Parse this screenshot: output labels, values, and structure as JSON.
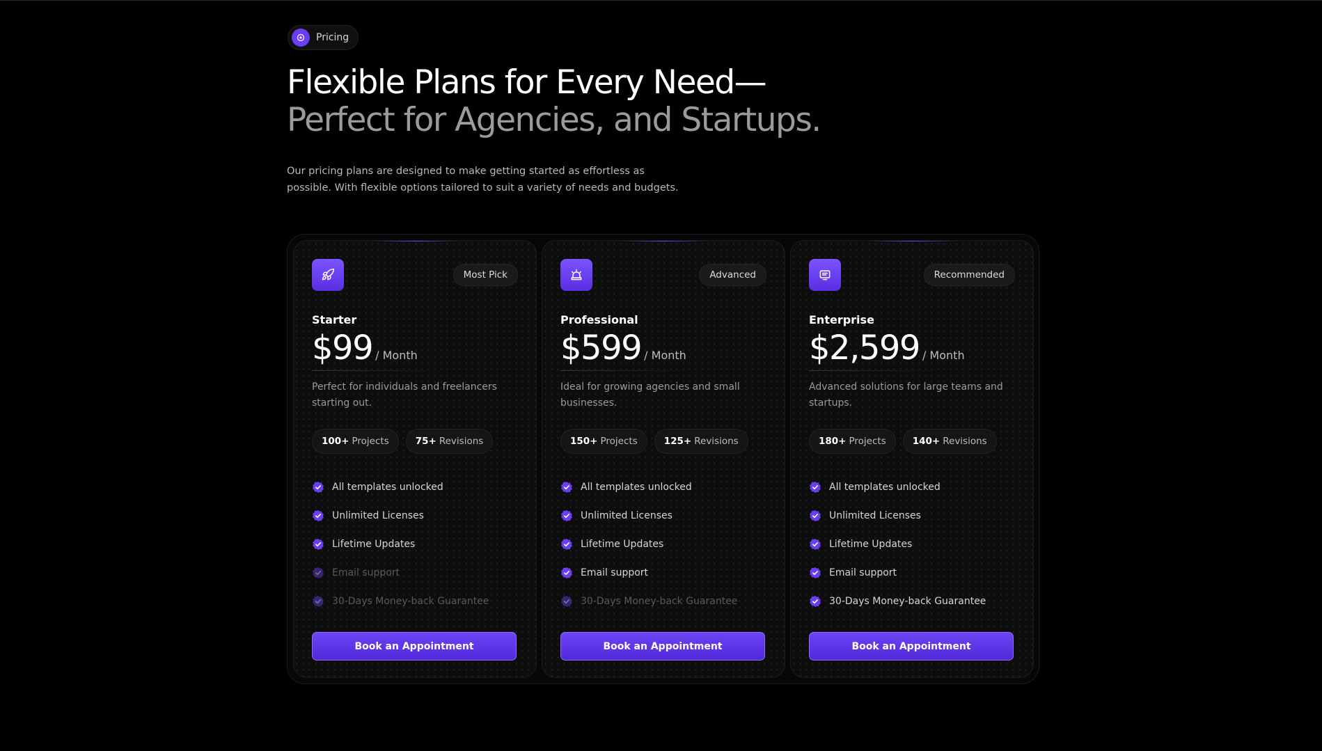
{
  "section_tag": {
    "label": "Pricing",
    "icon": "target-icon"
  },
  "headline": {
    "line1": "Flexible Plans for Every Need—",
    "line2": "Perfect for Agencies, and Startups."
  },
  "lead": "Our pricing plans are designed to make getting started as effortless as possible. With flexible options tailored to suit a variety of needs and budgets.",
  "colors": {
    "accent": "#6a3ff2",
    "background": "#000000",
    "card": "#0d0d0d"
  },
  "plans": [
    {
      "icon": "rocket-icon",
      "badge": "Most Pick",
      "name": "Starter",
      "price": "$99",
      "period": "/ Month",
      "description": "Perfect for individuals and freelancers starting out.",
      "stats": [
        {
          "value": "100+",
          "label": "Projects"
        },
        {
          "value": "75+",
          "label": "Revisions"
        }
      ],
      "features": [
        {
          "label": "All templates unlocked",
          "included": true
        },
        {
          "label": "Unlimited Licenses",
          "included": true
        },
        {
          "label": "Lifetime Updates",
          "included": true
        },
        {
          "label": "Email support",
          "included": false
        },
        {
          "label": "30-Days Money-back Guarantee",
          "included": false
        }
      ],
      "cta": "Book an Appointment"
    },
    {
      "icon": "alarm-bell-icon",
      "badge": "Advanced",
      "name": "Professional",
      "price": "$599",
      "period": "/ Month",
      "description": "Ideal for growing agencies and small businesses.",
      "stats": [
        {
          "value": "150+",
          "label": "Projects"
        },
        {
          "value": "125+",
          "label": "Revisions"
        }
      ],
      "features": [
        {
          "label": "All templates unlocked",
          "included": true
        },
        {
          "label": "Unlimited Licenses",
          "included": true
        },
        {
          "label": "Lifetime Updates",
          "included": true
        },
        {
          "label": "Email support",
          "included": true
        },
        {
          "label": "30-Days Money-back Guarantee",
          "included": false
        }
      ],
      "cta": "Book an Appointment"
    },
    {
      "icon": "document-icon",
      "badge": "Recommended",
      "name": "Enterprise",
      "price": "$2,599",
      "period": "/ Month",
      "description": "Advanced solutions for large teams and startups.",
      "stats": [
        {
          "value": "180+",
          "label": "Projects"
        },
        {
          "value": "140+",
          "label": "Revisions"
        }
      ],
      "features": [
        {
          "label": "All templates unlocked",
          "included": true
        },
        {
          "label": "Unlimited Licenses",
          "included": true
        },
        {
          "label": "Lifetime Updates",
          "included": true
        },
        {
          "label": "Email support",
          "included": true
        },
        {
          "label": "30-Days Money-back Guarantee",
          "included": true
        }
      ],
      "cta": "Book an Appointment"
    }
  ]
}
